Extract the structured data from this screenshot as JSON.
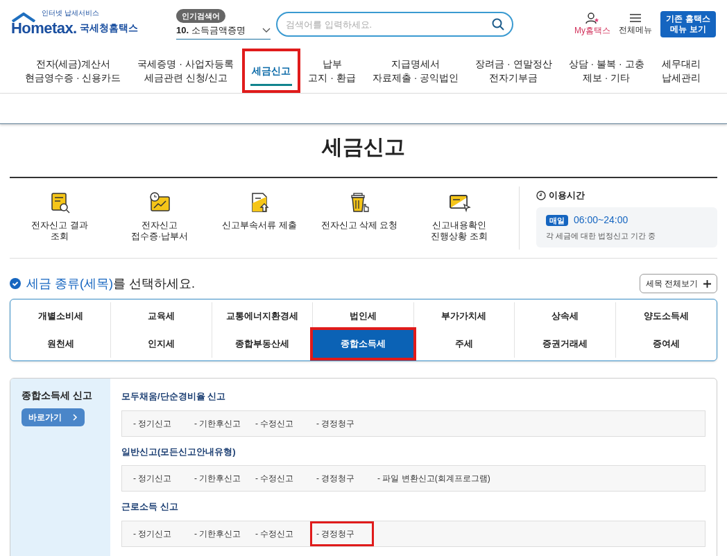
{
  "header": {
    "logo": {
      "tagline": "인터넷 납세서비스",
      "wordmark": "Hometax.",
      "name": "국세청홈택스"
    },
    "popular": {
      "label": "인기검색어",
      "rank": "10.",
      "term": "소득금액증명"
    },
    "search": {
      "placeholder": "검색어를 입력하세요."
    },
    "utilities": [
      {
        "kind": "my",
        "label": "My홈택스"
      },
      {
        "kind": "menu",
        "label": "전체메뉴"
      }
    ],
    "classic_button": [
      "기존 홈택스",
      "메뉴 보기"
    ]
  },
  "nav": [
    {
      "lines": [
        "전자(세금)계산서",
        "현금영수증 · 신용카드"
      ],
      "selected": false,
      "highlighted": false
    },
    {
      "lines": [
        "국세증명 · 사업자등록",
        "세금관련 신청/신고"
      ],
      "selected": false,
      "highlighted": false
    },
    {
      "lines": [
        "세금신고"
      ],
      "selected": true,
      "highlighted": true
    },
    {
      "lines": [
        "납부",
        "고지 · 환급"
      ],
      "selected": false,
      "highlighted": false
    },
    {
      "lines": [
        "지급명세서",
        "자료제출 · 공익법인"
      ],
      "selected": false,
      "highlighted": false
    },
    {
      "lines": [
        "장려금 · 연말정산",
        "전자기부금"
      ],
      "selected": false,
      "highlighted": false
    },
    {
      "lines": [
        "상담 · 불복 · 고충",
        "제보 · 기타"
      ],
      "selected": false,
      "highlighted": false
    },
    {
      "lines": [
        "세무대리",
        "납세관리"
      ],
      "selected": false,
      "highlighted": false
    }
  ],
  "page_title": "세금신고",
  "quick_menu": [
    {
      "kind": "result",
      "lines": [
        "전자신고 결과",
        "조회"
      ]
    },
    {
      "kind": "receipt",
      "lines": [
        "전자신고",
        "접수증·납부서"
      ]
    },
    {
      "kind": "document",
      "lines": [
        "신고부속서류 제출"
      ]
    },
    {
      "kind": "delete",
      "lines": [
        "전자신고 삭제 요청"
      ]
    },
    {
      "kind": "progress",
      "lines": [
        "신고내용확인",
        "진행상황 조회"
      ]
    }
  ],
  "usage_time": {
    "title": "이용시간",
    "badge": "매일",
    "hours": "06:00~24:00",
    "note": "각 세금에 대한 법정신고 기간 중"
  },
  "tax_select": {
    "heading_accent": "세금 종류(세목)",
    "heading_rest": "를 선택하세요.",
    "view_all_button": "세목 전체보기",
    "taxes": [
      {
        "label": "개별소비세",
        "selected": false,
        "highlighted": false
      },
      {
        "label": "교육세",
        "selected": false,
        "highlighted": false
      },
      {
        "label": "교통에너지환경세",
        "selected": false,
        "highlighted": false
      },
      {
        "label": "법인세",
        "selected": false,
        "highlighted": false
      },
      {
        "label": "부가가치세",
        "selected": false,
        "highlighted": false
      },
      {
        "label": "상속세",
        "selected": false,
        "highlighted": false
      },
      {
        "label": "양도소득세",
        "selected": false,
        "highlighted": false
      },
      {
        "label": "원천세",
        "selected": false,
        "highlighted": false
      },
      {
        "label": "인지세",
        "selected": false,
        "highlighted": false
      },
      {
        "label": "종합부동산세",
        "selected": false,
        "highlighted": false
      },
      {
        "label": "종합소득세",
        "selected": true,
        "highlighted": true
      },
      {
        "label": "주세",
        "selected": false,
        "highlighted": false
      },
      {
        "label": "증권거래세",
        "selected": false,
        "highlighted": false
      },
      {
        "label": "증여세",
        "selected": false,
        "highlighted": false
      }
    ]
  },
  "panel": {
    "title": "종합소득세 신고",
    "go_button": "바로가기",
    "groups": [
      {
        "title": "모두채움/단순경비율 신고",
        "links": [
          {
            "label": "- 정기신고",
            "highlighted": false
          },
          {
            "label": "- 기한후신고",
            "highlighted": false
          },
          {
            "label": "- 수정신고",
            "highlighted": false
          },
          {
            "label": "- 경정청구",
            "highlighted": false
          }
        ]
      },
      {
        "title": "일반신고(모든신고안내유형)",
        "links": [
          {
            "label": "- 정기신고",
            "highlighted": false
          },
          {
            "label": "- 기한후신고",
            "highlighted": false
          },
          {
            "label": "- 수정신고",
            "highlighted": false
          },
          {
            "label": "- 경정청구",
            "highlighted": false
          },
          {
            "label": "- 파일 변환신고(회계프로그램)",
            "highlighted": false
          }
        ]
      },
      {
        "title": "근로소득 신고",
        "links": [
          {
            "label": "- 정기신고",
            "highlighted": false
          },
          {
            "label": "- 기한후신고",
            "highlighted": false
          },
          {
            "label": "- 수정신고",
            "highlighted": false
          },
          {
            "label": "- 경정청구",
            "highlighted": true
          }
        ]
      }
    ]
  }
}
